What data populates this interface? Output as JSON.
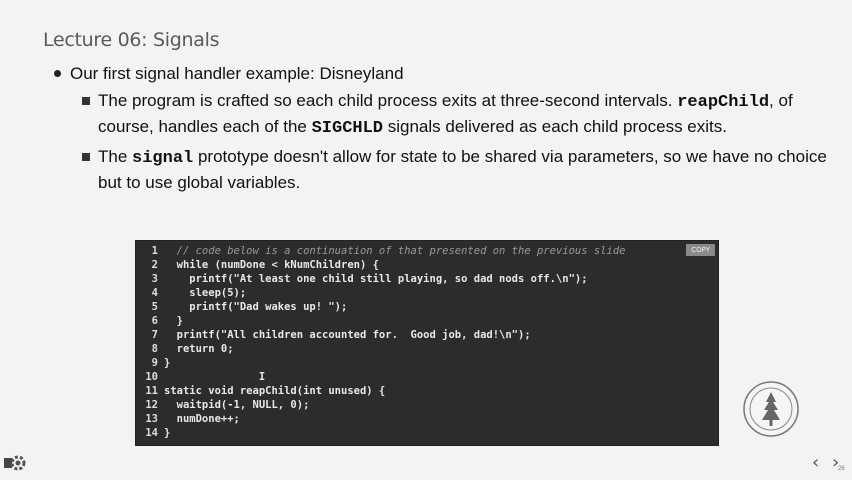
{
  "slide": {
    "title": "Lecture 06: Signals",
    "bullet1": "Our first signal handler example: Disneyland",
    "sub1": {
      "part1": "The program is crafted so each child process exits at three-second intervals. ",
      "kw1": "reapChild",
      "part2": ", of course, handles each of the ",
      "kw2": "SIGCHLD",
      "part3": " signals delivered as each child process exits."
    },
    "sub2": {
      "part1": "The ",
      "kw1": "signal",
      "part2": " prototype doesn't allow for state to be shared via parameters, so we have no choice but to use global variables."
    }
  },
  "code": {
    "copy_label": "COPY",
    "lines": [
      {
        "n": "1",
        "text": "  // code below is a continuation of that presented on the previous slide"
      },
      {
        "n": "2",
        "text": "  while (numDone < kNumChildren) {"
      },
      {
        "n": "3",
        "text": "    printf(\"At least one child still playing, so dad nods off.\\n\");"
      },
      {
        "n": "4",
        "text": "    sleep(5);"
      },
      {
        "n": "5",
        "text": "    printf(\"Dad wakes up! \");"
      },
      {
        "n": "6",
        "text": "  }"
      },
      {
        "n": "7",
        "text": "  printf(\"All children accounted for.  Good job, dad!\\n\");"
      },
      {
        "n": "8",
        "text": "  return 0;"
      },
      {
        "n": "9",
        "text": "}"
      },
      {
        "n": "10",
        "text": "               I"
      },
      {
        "n": "11",
        "text": "static void reapChild(int unused) {"
      },
      {
        "n": "12",
        "text": "  waitpid(-1, NULL, 0);"
      },
      {
        "n": "13",
        "text": "  numDone++;"
      },
      {
        "n": "14",
        "text": "}"
      }
    ]
  },
  "nav": {
    "prev_icon": "chevron-left-icon",
    "next_icon": "chevron-right-icon",
    "prev": "‹",
    "next": "›",
    "page": "26"
  }
}
